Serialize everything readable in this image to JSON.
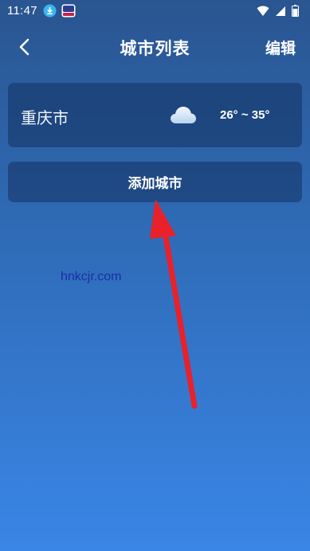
{
  "status_bar": {
    "time": "11:47",
    "icons": [
      "download-icon",
      "app-badge-icon",
      "wifi-icon",
      "signal-icon",
      "battery-icon"
    ]
  },
  "header": {
    "title": "城市列表",
    "edit_label": "编辑"
  },
  "cities": [
    {
      "name": "重庆市",
      "weather_icon": "cloud-icon",
      "temp_range": "26° ~ 35°"
    }
  ],
  "add_city_label": "添加城市",
  "watermark": "hnkcjr.com",
  "colors": {
    "arrow": "#e8212b",
    "watermark": "#1a2fa8"
  }
}
